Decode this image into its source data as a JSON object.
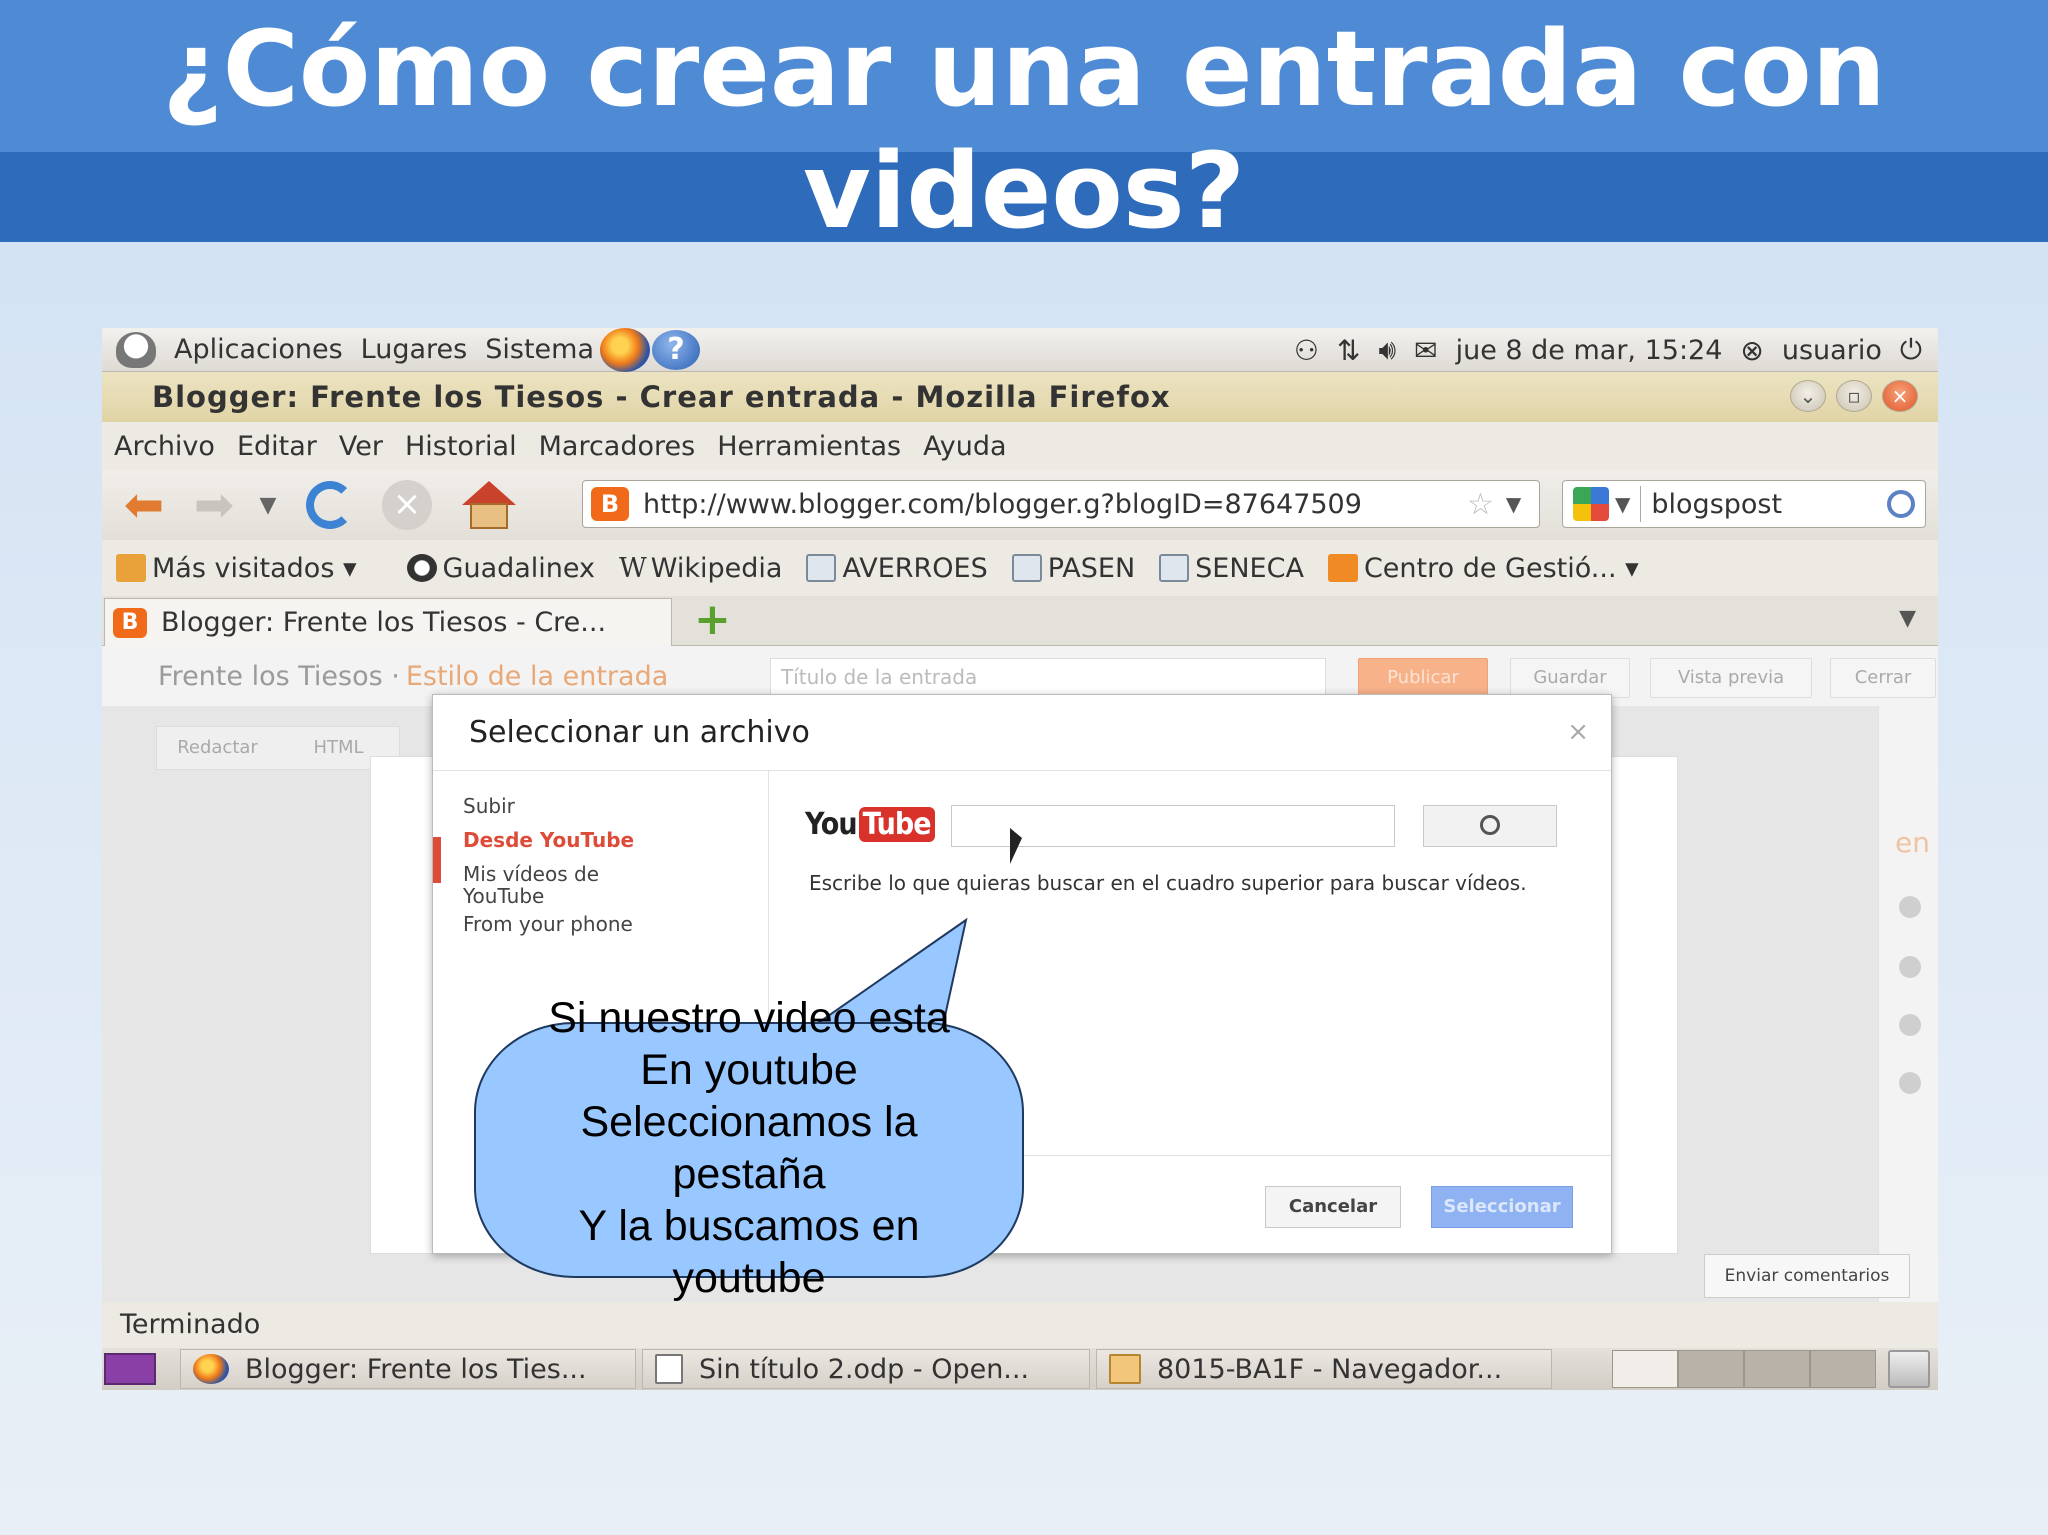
{
  "slide": {
    "title": "¿Cómo crear una entrada con videos?"
  },
  "gnome_panel": {
    "menus": [
      "Aplicaciones",
      "Lugares",
      "Sistema"
    ],
    "datetime": "jue  8 de mar, 15:24",
    "user": "usuario"
  },
  "window": {
    "title": "Blogger: Frente los Tiesos - Crear entrada - Mozilla Firefox"
  },
  "menubar": [
    "Archivo",
    "Editar",
    "Ver",
    "Historial",
    "Marcadores",
    "Herramientas",
    "Ayuda"
  ],
  "navbar": {
    "url": "http://www.blogger.com/blogger.g?blogID=87647509",
    "search_value": "blogspost"
  },
  "bookmarks": [
    "Más visitados ▾",
    "Guadalinex",
    "Wikipedia",
    "AVERROES",
    "PASEN",
    "SENECA",
    "Centro de Gestió... ▾"
  ],
  "tab": {
    "label": "Blogger: Frente los Tiesos - Cre..."
  },
  "blogger": {
    "blog_name": "Frente los Tiesos ·",
    "breadcrumb": "Estilo de la entrada",
    "title_placeholder": "Título de la entrada",
    "buttons": {
      "publish": "Publicar",
      "save": "Guardar",
      "preview": "Vista previa",
      "close": "Cerrar"
    },
    "mode_tabs": [
      "Redactar",
      "HTML"
    ],
    "side_text": "en",
    "feedback": "Enviar comentarios"
  },
  "dialog": {
    "title": "Seleccionar un archivo",
    "close": "×",
    "nav": [
      "Subir",
      "Desde YouTube",
      "Mis vídeos de YouTube",
      "From your phone"
    ],
    "yt_logo_you": "You",
    "yt_logo_tube": "Tube",
    "hint": "Escribe lo que quieras buscar en el cuadro superior para buscar vídeos.",
    "cancel": "Cancelar",
    "select": "Seleccionar"
  },
  "status": "Terminado",
  "taskbar": {
    "items": [
      "Blogger: Frente los Ties...",
      "Sin título 2.odp - Open...",
      "8015-BA1F - Navegador..."
    ]
  },
  "callout": {
    "lines": [
      "Si nuestro video esta",
      "En youtube",
      "Seleccionamos la",
      "pestaña",
      "Y la buscamos en",
      "youtube"
    ]
  },
  "colors": {
    "title_band": "#4f8bd4",
    "youtube_red": "#d8322b",
    "active_nav": "#dd4b39",
    "callout_fill": "#99c7ff"
  }
}
